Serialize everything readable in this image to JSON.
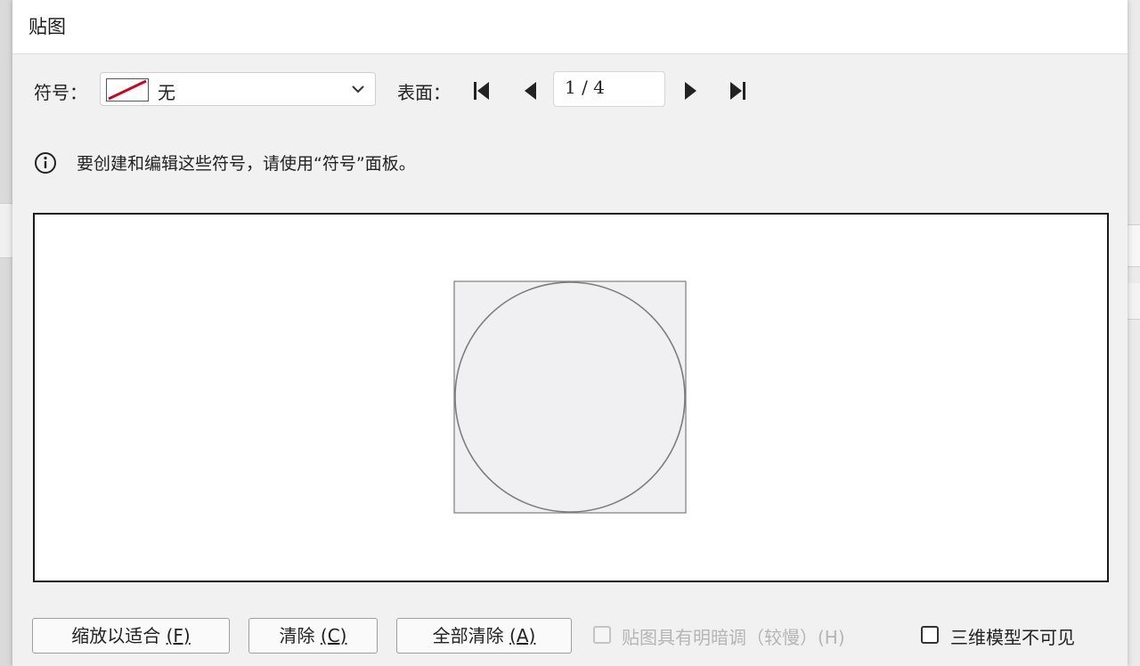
{
  "dialog": {
    "title": "贴图"
  },
  "toolbar": {
    "symbol_label": "符号：",
    "symbol_value": "无",
    "surface_label": "表面：",
    "page_value": "1 / 4"
  },
  "info": {
    "text": "要创建和编辑这些符号，请使用“符号”面板。"
  },
  "buttons": {
    "fit_label": "缩放以适合",
    "fit_key": "(F)",
    "clear_label": "清除",
    "clear_key": "(C)",
    "clear_all_label": "全部清除",
    "clear_all_key": "(A)"
  },
  "options": {
    "shade_label": "贴图具有明暗调（较慢）(H)",
    "shade_checked": false,
    "shade_enabled": false,
    "invisible_label": "三维模型不可见",
    "invisible_checked": false
  },
  "icons": {
    "first_page": "first-page-icon",
    "prev_page": "prev-page-icon",
    "next_page": "next-page-icon",
    "last_page": "last-page-icon",
    "info": "info-icon",
    "dropdown": "chevron-down-icon"
  },
  "colors": {
    "swatch_slash": "#d0021b"
  }
}
